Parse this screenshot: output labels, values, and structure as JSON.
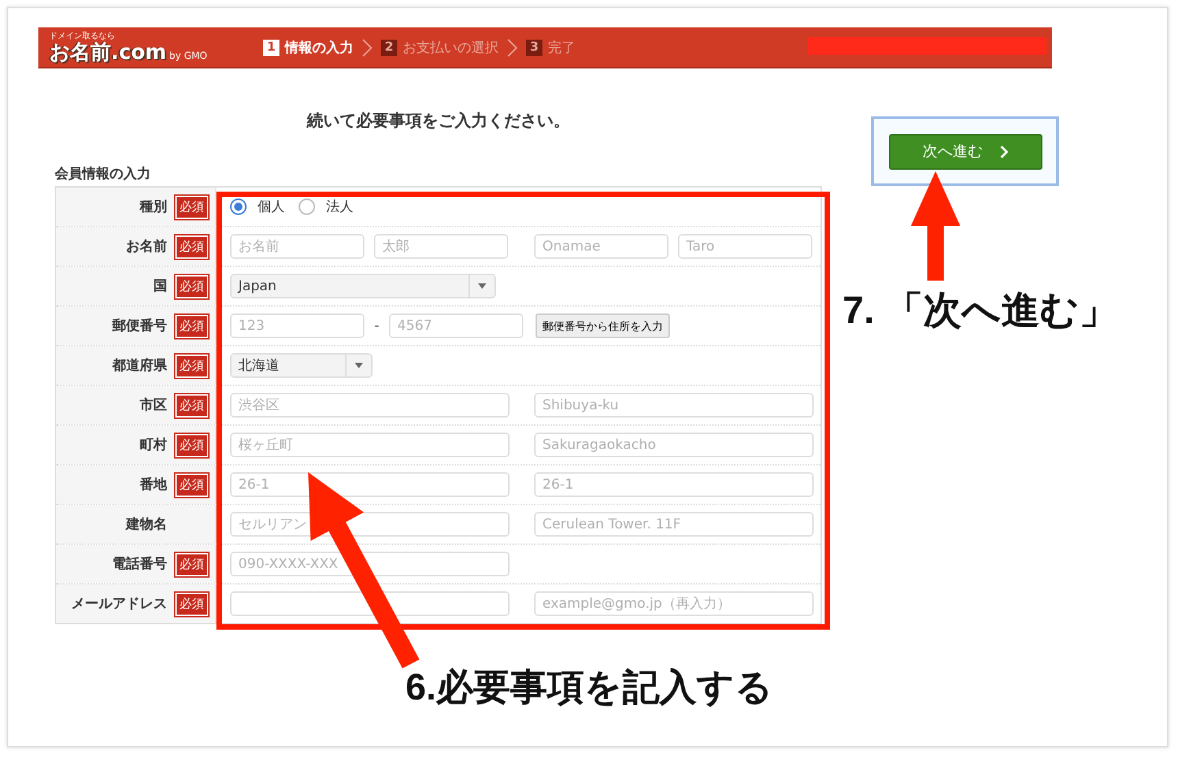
{
  "header": {
    "logo": {
      "tagline": "ドメイン取るなら",
      "name": "お名前.com",
      "suffix": "by GMO"
    },
    "steps": [
      {
        "number": "1",
        "label": "情報の入力",
        "selected": true
      },
      {
        "number": "2",
        "label": "お支払いの選択",
        "selected": false
      },
      {
        "number": "3",
        "label": "完了",
        "selected": false
      }
    ]
  },
  "title": "続いて必要事項をご入力ください。",
  "section_title": "会員情報の入力",
  "rows": [
    {
      "label": "種別",
      "badge": "必須",
      "kind": "radio",
      "options": [
        {
          "label": "個人",
          "selected": true
        },
        {
          "label": "法人",
          "selected": false
        }
      ]
    },
    {
      "label": "お名前",
      "badge": "必須",
      "kind": "quad",
      "fields": [
        {
          "placeholder": "お名前"
        },
        {
          "placeholder": "太郎"
        },
        {
          "placeholder": "Onamae"
        },
        {
          "placeholder": "Taro"
        }
      ]
    },
    {
      "label": "国",
      "badge": "必須",
      "kind": "select",
      "value": "Japan"
    },
    {
      "label": "郵便番号",
      "badge": "必須",
      "kind": "postal",
      "fields": [
        {
          "placeholder": "123"
        },
        {
          "placeholder": "4567"
        }
      ],
      "separator": "-",
      "button": "郵便番号から住所を入力"
    },
    {
      "label": "都道府県",
      "badge": "必須",
      "kind": "shortselect",
      "value": "北海道"
    },
    {
      "label": "市区",
      "badge": "必須",
      "kind": "pair",
      "fields": [
        {
          "placeholder": "渋谷区"
        },
        {
          "placeholder": "Shibuya-ku"
        }
      ]
    },
    {
      "label": "町村",
      "badge": "必須",
      "kind": "pair",
      "fields": [
        {
          "placeholder": "桜ヶ丘町"
        },
        {
          "placeholder": "Sakuragaokacho"
        }
      ]
    },
    {
      "label": "番地",
      "badge": "必須",
      "kind": "pair",
      "fields": [
        {
          "placeholder": "26-1"
        },
        {
          "placeholder": "26-1"
        }
      ]
    },
    {
      "label": "建物名",
      "kind": "pair",
      "fields": [
        {
          "placeholder": "セルリアン"
        },
        {
          "placeholder": "Cerulean Tower. 11F"
        }
      ]
    },
    {
      "label": "電話番号",
      "badge": "必須",
      "kind": "single",
      "fields": [
        {
          "placeholder": "090-XXXX-XXX"
        }
      ]
    },
    {
      "label": "メールアドレス",
      "badge": "必須",
      "kind": "blankpair",
      "fields": [
        {
          "placeholder": "example@gmo.jp（再入力）"
        }
      ]
    }
  ],
  "next_button": {
    "label": "次へ進む"
  },
  "annotations": [
    {
      "kind": "fields",
      "text": "6.必要事項を記入する"
    },
    {
      "kind": "button",
      "text": "7. 「次へ進む」"
    }
  ]
}
